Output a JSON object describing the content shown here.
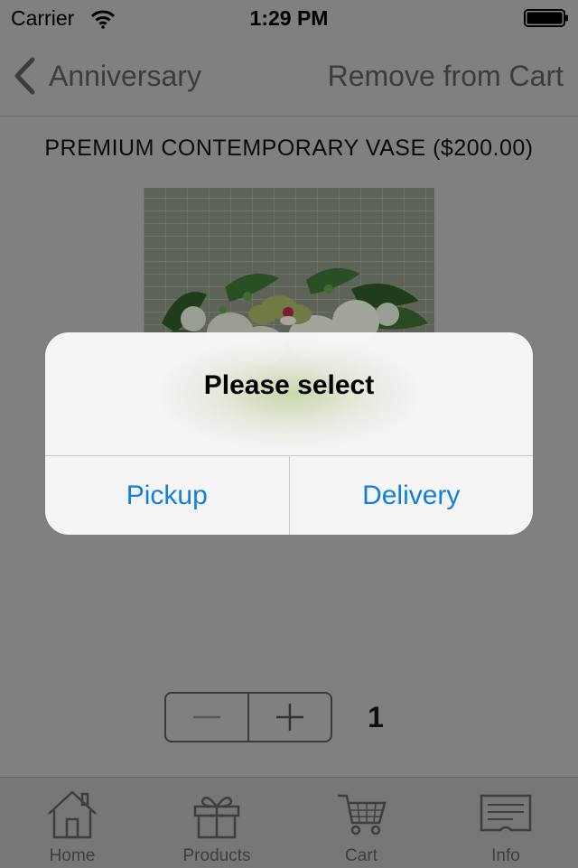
{
  "status_bar": {
    "carrier": "Carrier",
    "time": "1:29 PM"
  },
  "nav": {
    "back_label": "Anniversary",
    "action_label": "Remove from Cart"
  },
  "product": {
    "title": "PREMIUM CONTEMPORARY VASE ($200.00)"
  },
  "quantity": {
    "value": "1"
  },
  "tab_bar": {
    "items": [
      {
        "label": "Home",
        "icon": "home-icon"
      },
      {
        "label": "Products",
        "icon": "gift-icon"
      },
      {
        "label": "Cart",
        "icon": "cart-icon"
      },
      {
        "label": "Info",
        "icon": "info-card-icon"
      }
    ]
  },
  "alert": {
    "title": "Please select",
    "buttons": [
      "Pickup",
      "Delivery"
    ]
  },
  "colors": {
    "accent": "#117fe0",
    "overlay": "#808080",
    "alert_bg": "#f7f7f7"
  }
}
